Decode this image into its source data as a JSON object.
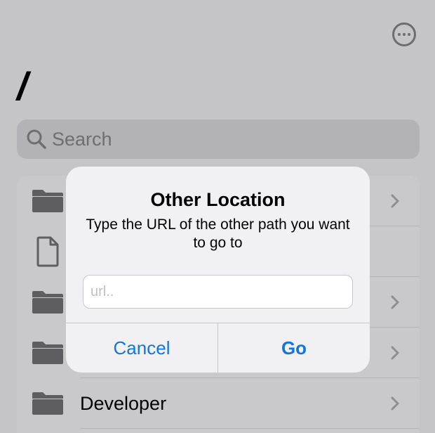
{
  "header": {
    "title": "/",
    "more_icon": "ellipsis-circle-icon"
  },
  "search": {
    "placeholder": "Search",
    "icon": "magnifyingglass-icon"
  },
  "list": {
    "rows": [
      {
        "label": "",
        "icon": "folder-icon"
      },
      {
        "label": "",
        "icon": "document-icon"
      },
      {
        "label": "",
        "icon": "folder-icon"
      },
      {
        "label": "",
        "icon": "folder-icon"
      },
      {
        "label": "Developer",
        "icon": "folder-icon"
      }
    ]
  },
  "alert": {
    "title": "Other Location",
    "message": "Type the URL of the other path you want to go to",
    "input_placeholder": "url..",
    "input_value": "",
    "cancel_label": "Cancel",
    "go_label": "Go"
  },
  "colors": {
    "accent": "#1275e0",
    "dimmed_background": "#c5c5c8",
    "alert_background": "#f1f1f3"
  }
}
